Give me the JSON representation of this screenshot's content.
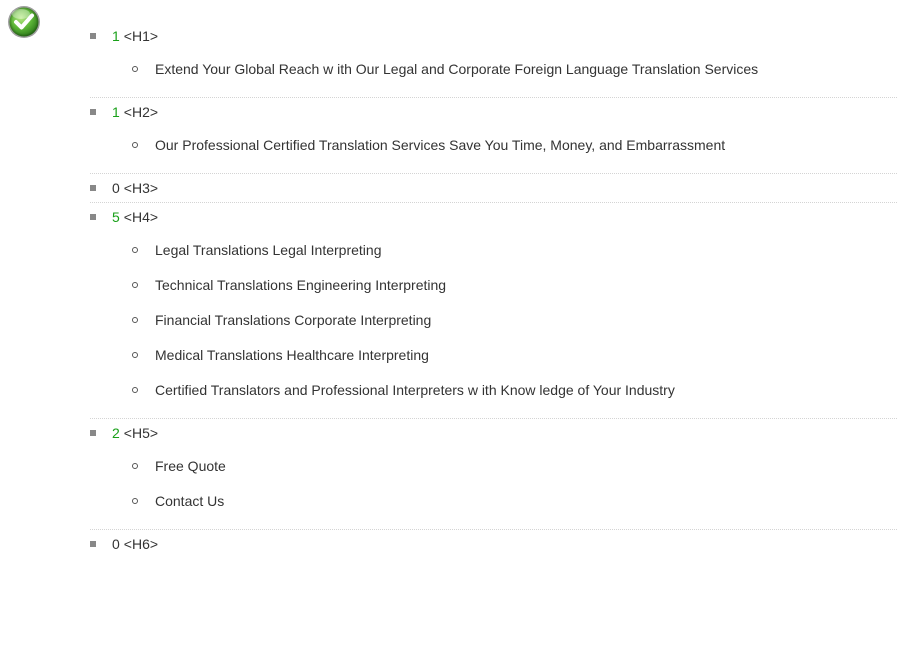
{
  "status": {
    "icon": "checkmark-icon",
    "color": "#4caf50"
  },
  "headings": [
    {
      "count": "1",
      "tag": "<H1>",
      "items": [
        "Extend Your Global Reach w ith Our Legal and Corporate Foreign Language Translation Services"
      ]
    },
    {
      "count": "1",
      "tag": "<H2>",
      "items": [
        "Our Professional Certified Translation Services Save You Time, Money, and Embarrassment"
      ]
    },
    {
      "count": "0",
      "tag": "<H3>",
      "items": []
    },
    {
      "count": "5",
      "tag": "<H4>",
      "items": [
        "Legal Translations Legal Interpreting",
        "Technical Translations Engineering Interpreting",
        "Financial Translations Corporate Interpreting",
        "Medical Translations Healthcare Interpreting",
        "Certified Translators and Professional Interpreters w ith Know ledge of Your Industry"
      ]
    },
    {
      "count": "2",
      "tag": "<H5>",
      "items": [
        "Free Quote",
        "Contact Us"
      ]
    },
    {
      "count": "0",
      "tag": "<H6>",
      "items": []
    }
  ],
  "colors": {
    "count_positive": "#19a019",
    "count_zero": "#333333",
    "text": "#333333",
    "divider": "#d4d4d4"
  }
}
